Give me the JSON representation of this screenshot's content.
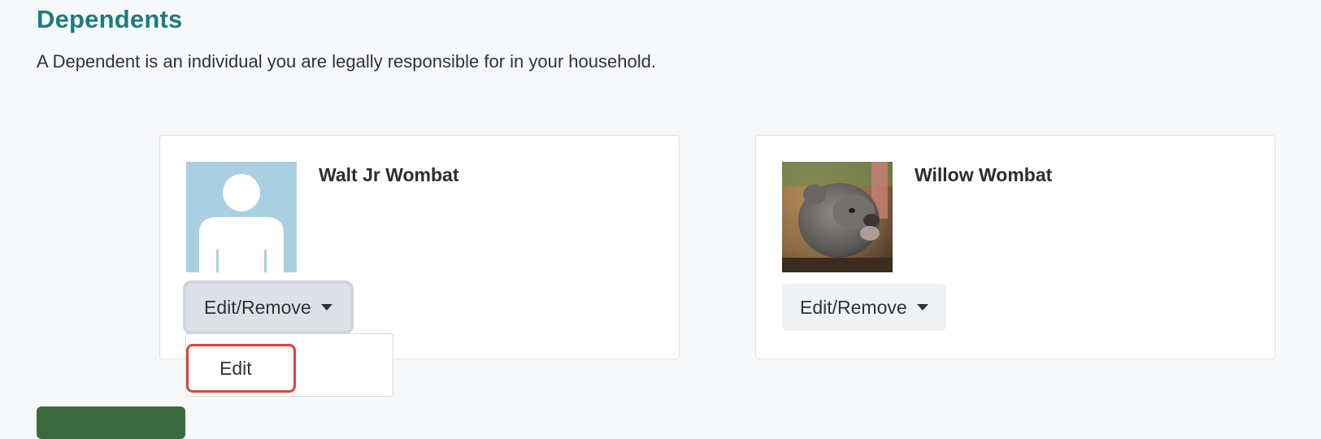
{
  "section": {
    "title": "Dependents",
    "description": "A Dependent is an individual you are legally responsible for in your household."
  },
  "dependents": [
    {
      "name": "Walt Jr Wombat",
      "photo": "placeholder-avatar-icon",
      "menu_label": "Edit/Remove",
      "menu_open": true
    },
    {
      "name": "Willow Wombat",
      "photo": "wombat-photo",
      "menu_label": "Edit/Remove",
      "menu_open": false
    }
  ],
  "dropdown": {
    "items": [
      "Edit"
    ]
  },
  "colors": {
    "title": "#1e7b80",
    "avatar_bg": "#a9cfe0",
    "highlight": "#d6483a",
    "primary_button": "#3c6a3e"
  }
}
